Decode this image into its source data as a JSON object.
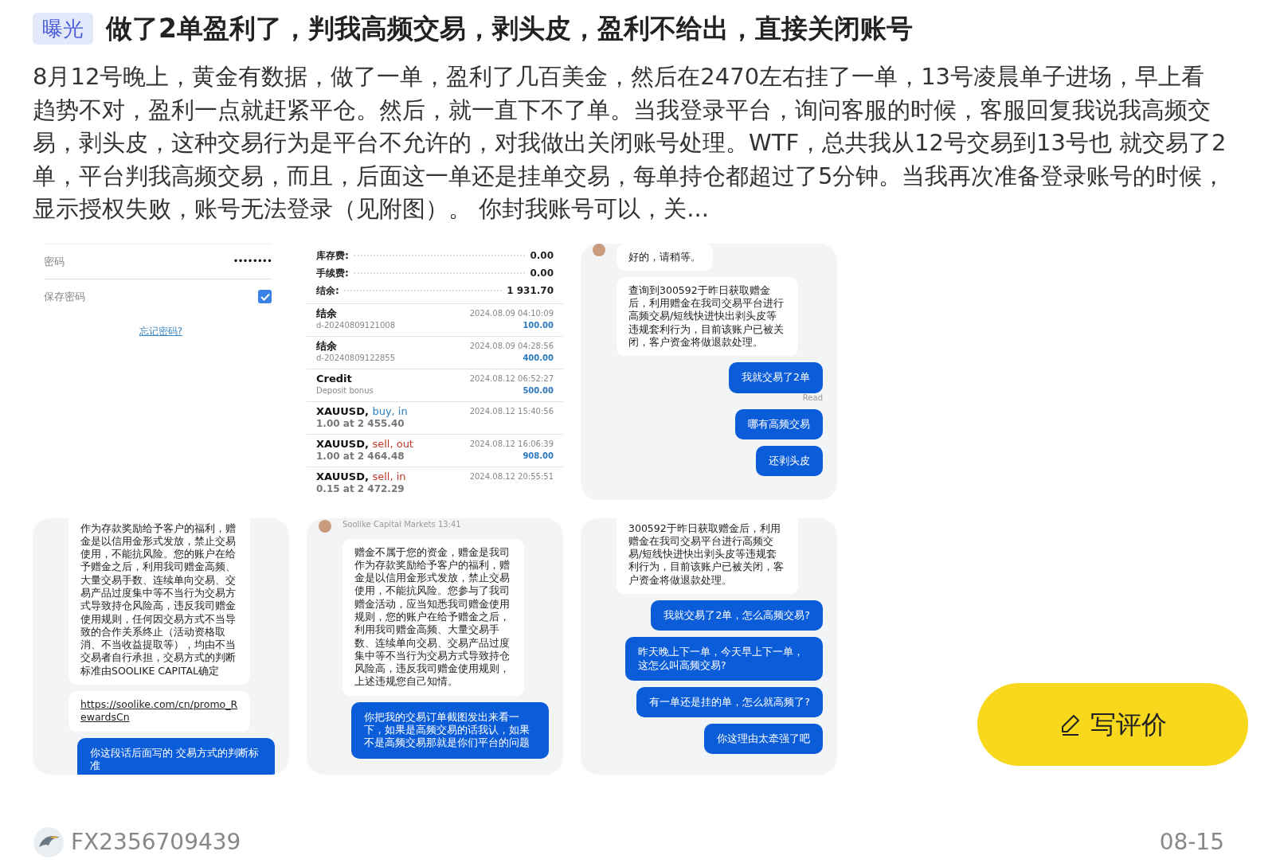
{
  "post": {
    "tag": "曝光",
    "title": "做了2单盈利了，判我高频交易，剥头皮，盈利不给出，直接关闭账号",
    "body": "8月12号晚上，黄金有数据，做了一单，盈利了几百美金，然后在2470左右挂了一单，13号凌晨单子进场，早上看趋势不对，盈利一点就赶紧平仓。然后，就一直下不了单。当我登录平台，询问客服的时候，客服回复我说我高频交易，剥头皮，这种交易行为是平台不允许的，对我做出关闭账号处理。WTF，总共我从12号交易到13号也 就交易了2单，平台判我高频交易，而且，后面这一单还是挂单交易，每单持仓都超过了5分钟。当我再次准备登录账号的时候，显示授权失败，账号无法登录（见附图）。 你封我账号可以，关..."
  },
  "images": [
    {
      "kind": "login",
      "password_label": "密码",
      "password_value": "••••••••",
      "remember_label": "保存密码",
      "remember_checked": true,
      "forgot_link": "忘记密码?"
    },
    {
      "kind": "history",
      "summary": [
        {
          "label": "库存费:",
          "value": "0.00"
        },
        {
          "label": "手续费:",
          "value": "0.00"
        },
        {
          "label": "结余:",
          "value": "1 931.70"
        }
      ],
      "deals": [
        {
          "kind": "balance",
          "title": "结余",
          "subtitle": "d-20240809121008",
          "time": "2024.08.09 04:10:09",
          "amount": "100.00"
        },
        {
          "kind": "balance",
          "title": "结余",
          "subtitle": "d-20240809122855",
          "time": "2024.08.09 04:28:56",
          "amount": "400.00"
        },
        {
          "kind": "balance",
          "title": "Credit",
          "subtitle": "Deposit bonus",
          "time": "2024.08.12 06:52:27",
          "amount": "500.00"
        },
        {
          "kind": "buy",
          "title": "XAUUSD,",
          "action": "buy, in",
          "subtitle": "1.00 at 2 455.40",
          "time": "2024.08.12 15:40:56"
        },
        {
          "kind": "sell",
          "title": "XAUUSD,",
          "action": "sell, out",
          "subtitle": "1.00 at 2 464.48",
          "time": "2024.08.12 16:06:39",
          "amount": "908.00"
        },
        {
          "kind": "sell",
          "title": "XAUUSD,",
          "action": "sell, in",
          "subtitle": "0.15 at 2 472.29",
          "time": "2024.08.12 20:55:51"
        }
      ]
    },
    {
      "kind": "chat",
      "messages": [
        {
          "kind": "received",
          "avatar": true,
          "text": "好的，请稍等。"
        },
        {
          "kind": "received",
          "text": "查询到300592于昨日获取赠金后，利用赠金在我司交易平台进行高频交易/短线快进快出剥头皮等违规套利行为，目前该账户已被关闭，客户资金将做退款处理。"
        },
        {
          "kind": "sent",
          "text": "我就交易了2单",
          "receipt": "Read"
        },
        {
          "kind": "sent",
          "text": "哪有高频交易"
        },
        {
          "kind": "sent",
          "text": "还剥头皮"
        }
      ]
    },
    {
      "kind": "chat",
      "messages": [
        {
          "kind": "received",
          "text": "作为存款奖励给予客户的福利，赠金是以信用金形式发放，禁止交易使用，不能抗风险。您的账户在给予赠金之后，利用我司赠金高频、大量交易手数、连续单向交易、交易产品过度集中等不当行为交易方式导致持仓风险高，违反我司赠金使用规则，任何因交易方式不当导致的合作关系终止（活动资格取消、不当收益提取等），均由不当交易者自行承担，交易方式的判断标准由SOOLIKE CAPITAL确定"
        },
        {
          "kind": "link",
          "text": "https://soolike.com/cn/promo_RewardsCn"
        },
        {
          "kind": "sent",
          "text": "你这段话后面写的 交易方式的判断标准"
        }
      ]
    },
    {
      "kind": "chat",
      "sender": "Soolike Capital Markets 13:41",
      "messages": [
        {
          "kind": "received",
          "avatar": true,
          "text": "赠金不属于您的资金，赠金是我司作为存款奖励给予客户的福利，赠金是以信用金形式发放，禁止交易使用，不能抗风险。您参与了我司赠金活动，应当知悉我司赠金使用规则，您的账户在给予赠金之后，利用我司赠金高频、大量交易手数、连续单向交易、交易产品过度集中等不当行为交易方式导致持仓风险高，违反我司赠金使用规则，上述违规您自己知情。"
        },
        {
          "kind": "sent",
          "text": "你把我的交易订单截图发出来看一下，如果是高频交易的话我认，如果不是高频交易那就是你们平台的问题"
        }
      ]
    },
    {
      "kind": "chat",
      "messages": [
        {
          "kind": "received",
          "text": "300592于昨日获取赠金后，利用赠金在我司交易平台进行高频交易/短线快进快出剥头皮等违规套利行为，目前该账户已被关闭，客户资金将做退款处理。"
        },
        {
          "kind": "sent",
          "text": "我就交易了2单，怎么高频交易?"
        },
        {
          "kind": "sent",
          "text": "昨天晚上下一单，今天早上下一单，这怎么叫高频交易?"
        },
        {
          "kind": "sent",
          "text": "有一单还是挂的单，怎么就高频了?"
        },
        {
          "kind": "sent",
          "text": "你这理由太牵强了吧"
        }
      ]
    }
  ],
  "review_button": "写评价",
  "footer": {
    "user": "FX2356709439",
    "date": "08-15"
  }
}
